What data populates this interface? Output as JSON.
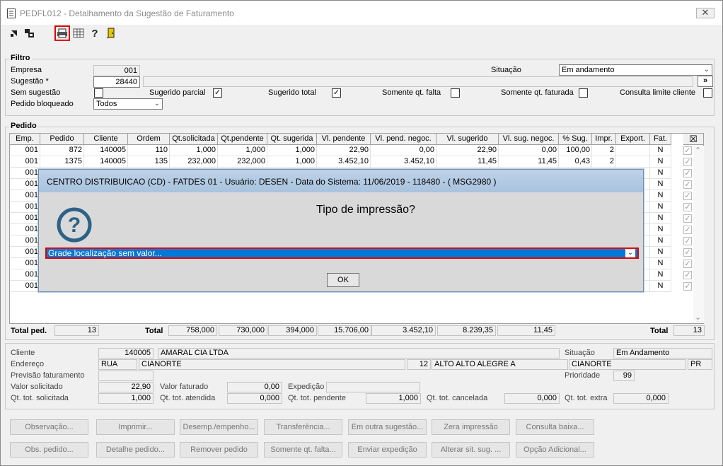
{
  "window": {
    "title": "PEDFL012 - Detalhamento da Sugestão de Faturamento",
    "close": "✕"
  },
  "toolbar": {
    "help": "?"
  },
  "filtro": {
    "legend": "Filtro",
    "empresa_label": "Empresa",
    "empresa_value": "001",
    "sugestao_label": "Sugestão *",
    "sugestao_value": "28440",
    "sugestao_btn": "»",
    "situacao_label": "Situação",
    "situacao_value": "Em andamento",
    "sem_sugestao": "Sem sugestão",
    "sugerido_parcial": "Sugerido parcial",
    "sugerido_total": "Sugerido total",
    "somente_falta": "Somente qt. falta",
    "somente_faturada": "Somente qt. faturada",
    "consulta_limite": "Consulta limite cliente",
    "pedido_bloqueado_label": "Pedido bloqueado",
    "pedido_bloqueado_value": "Todos"
  },
  "pedido": {
    "legend": "Pedido",
    "columns": [
      "Emp.",
      "Pedido",
      "Cliente",
      "Ordem",
      "Qt.solicitada",
      "Qt.pendente",
      "Qt. sugerida",
      "Vl. pendente",
      "Vl. pend. negoc.",
      "Vl. sugerido",
      "Vl. sug. negoc.",
      "% Sug.",
      "Impr.",
      "Export.",
      "Fat."
    ],
    "select_all_icon": "☒",
    "rows": [
      [
        "001",
        "872",
        "140005",
        "110",
        "1,000",
        "1,000",
        "1,000",
        "22,90",
        "0,00",
        "22,90",
        "0,00",
        "100,00",
        "2",
        "",
        "N"
      ],
      [
        "001",
        "1375",
        "140005",
        "135",
        "232,000",
        "232,000",
        "1,000",
        "3.452,10",
        "3.452,10",
        "11,45",
        "11,45",
        "0,43",
        "2",
        "",
        "N"
      ],
      [
        "001",
        "",
        "",
        "",
        "",
        "",
        "",
        "",
        "",
        "",
        "",
        "",
        "",
        "",
        "N"
      ],
      [
        "001",
        "",
        "",
        "",
        "",
        "",
        "",
        "",
        "",
        "",
        "",
        "",
        "",
        "",
        "N"
      ],
      [
        "001",
        "",
        "",
        "",
        "",
        "",
        "",
        "",
        "",
        "",
        "",
        "",
        "",
        "",
        "N"
      ],
      [
        "001",
        "",
        "",
        "",
        "",
        "",
        "",
        "",
        "",
        "",
        "",
        "",
        "",
        "",
        "N"
      ],
      [
        "001",
        "",
        "",
        "",
        "",
        "",
        "",
        "",
        "",
        "",
        "",
        "",
        "",
        "",
        "N"
      ],
      [
        "001",
        "",
        "",
        "",
        "",
        "",
        "",
        "",
        "",
        "",
        "",
        "",
        "",
        "",
        "N"
      ],
      [
        "001",
        "",
        "",
        "",
        "",
        "",
        "",
        "",
        "",
        "",
        "",
        "",
        "",
        "",
        "N"
      ],
      [
        "001",
        "",
        "",
        "",
        "",
        "",
        "",
        "",
        "",
        "",
        "",
        "",
        "",
        "",
        "N"
      ],
      [
        "001",
        "",
        "",
        "",
        "",
        "",
        "",
        "",
        "",
        "",
        "",
        "",
        "",
        "",
        "N"
      ],
      [
        "001",
        "",
        "",
        "",
        "",
        "",
        "",
        "",
        "",
        "",
        "",
        "",
        "",
        "",
        "N"
      ],
      [
        "001",
        "",
        "",
        "",
        "",
        "",
        "",
        "",
        "",
        "",
        "",
        "",
        "",
        "",
        "N"
      ]
    ],
    "check": "✓",
    "scroll_up": "⌃",
    "scroll_down": "⌄",
    "total_ped_label": "Total ped.",
    "total_ped_value": "13",
    "total_label": "Total",
    "totals": [
      "758,000",
      "730,000",
      "394,000",
      "15.706,00",
      "3.452,10",
      "8.239,35",
      "11,45"
    ],
    "total_right_label": "Total",
    "total_right_value": "13"
  },
  "details": {
    "cliente_label": "Cliente",
    "cliente_code": "140005",
    "cliente_name": "AMARAL CIA LTDA",
    "situacao_label": "Situação",
    "situacao_value": "Em Andamento",
    "endereco_label": "Endereço",
    "endereco_tipo": "RUA",
    "endereco_rua": "CIANORTE",
    "endereco_num": "12",
    "endereco_bairro": "ALTO ALTO ALEGRE A",
    "endereco_cidade": "CIANORTE",
    "endereco_uf": "PR",
    "previsao_label": "Previsão faturamento",
    "prioridade_label": "Prioridade",
    "prioridade_value": "99",
    "valor_solicitado_label": "Valor solicitado",
    "valor_solicitado_value": "22,90",
    "valor_faturado_label": "Valor faturado",
    "valor_faturado_value": "0,00",
    "expedicao_label": "Expedição",
    "qt_solicitada_label": "Qt. tot. solicitada",
    "qt_solicitada_value": "1,000",
    "qt_atendida_label": "Qt. tot. atendida",
    "qt_atendida_value": "0,000",
    "qt_pendente_label": "Qt. tot. pendente",
    "qt_pendente_value": "1,000",
    "qt_cancelada_label": "Qt. tot. cancelada",
    "qt_cancelada_value": "0,000",
    "qt_extra_label": "Qt. tot. extra",
    "qt_extra_value": "0,000"
  },
  "buttons": {
    "row1": [
      "Observação...",
      "Imprimir...",
      "Desemp./empenho...",
      "Transferência...",
      "Em outra sugestão...",
      "Zera impressão",
      "Consulta baixa..."
    ],
    "row2": [
      "Obs. pedido...",
      "Detalhe pedido...",
      "Remover pedido",
      "Somente qt. falta...",
      "Enviar expedição",
      "Alterar sit. sug. ...",
      "Opção Adicional..."
    ]
  },
  "modal": {
    "header": "CENTRO DISTRIBUICAO (CD) - FATDES 01 - Usuário: DESEN - Data do Sistema: 11/06/2019 - 118480 - ( MSG2980 )",
    "question": "Tipo de impressão?",
    "select_value": "Grade localização sem valor...",
    "ok": "OK",
    "question_icon": "?"
  },
  "colors": {
    "accent": "#0078d7",
    "highlight": "#e00000",
    "icon_blue": "#2d6187"
  }
}
